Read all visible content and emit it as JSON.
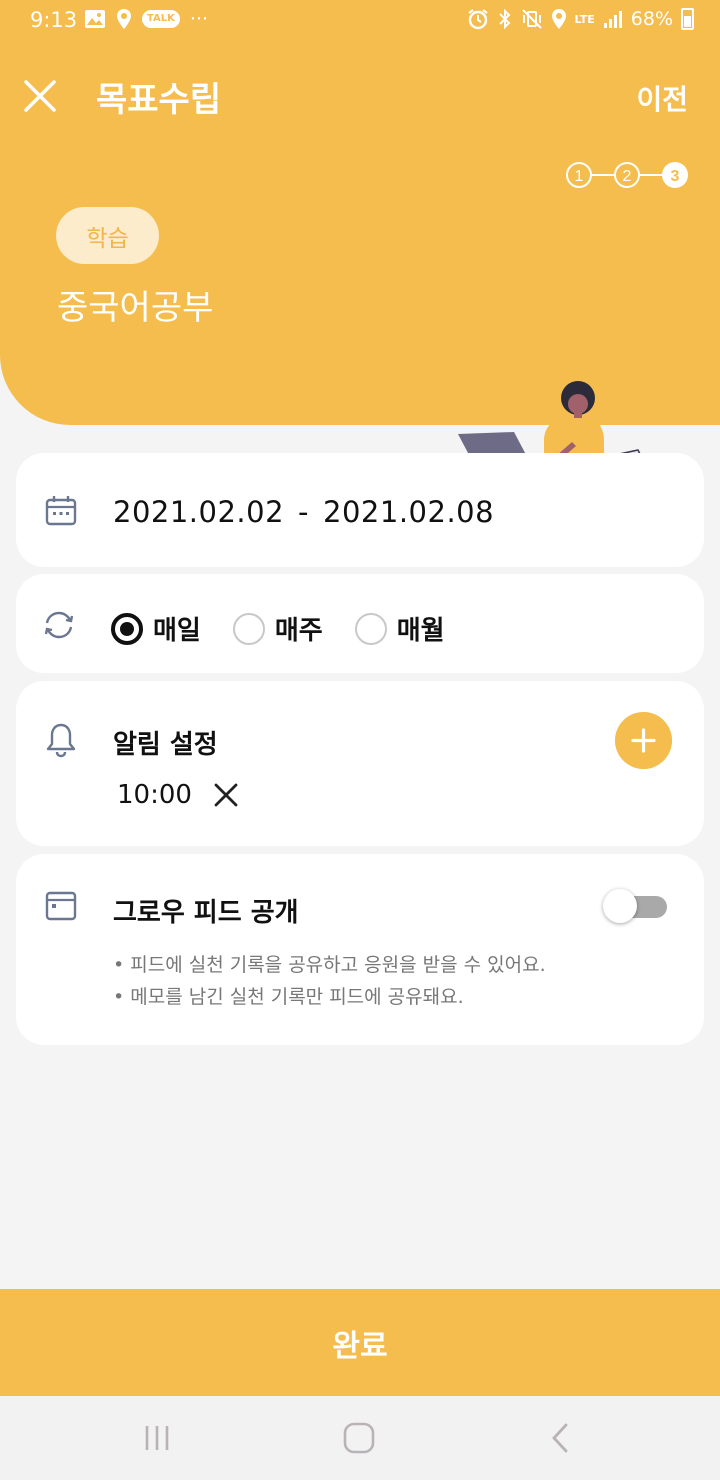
{
  "status_bar": {
    "time": "9:13",
    "talk_badge": "TALK",
    "more": "···",
    "network": "LTE",
    "battery": "68%"
  },
  "header": {
    "title": "목표수립",
    "prev_label": "이전",
    "steps": [
      "1",
      "2",
      "3"
    ],
    "current_step": 3
  },
  "goal": {
    "category": "학습",
    "name": "중국어공부"
  },
  "period": {
    "start": "2021.02.02",
    "separator": "-",
    "end": "2021.02.08"
  },
  "repeat": {
    "options": [
      {
        "label": "매일",
        "selected": true
      },
      {
        "label": "매주",
        "selected": false
      },
      {
        "label": "매월",
        "selected": false
      }
    ]
  },
  "alarm": {
    "title": "알림 설정",
    "time": "10:00"
  },
  "feed": {
    "title": "그로우 피드 공개",
    "enabled": false,
    "notes": [
      "• 피드에 실천 기록을 공유하고 응원을 받을 수 있어요.",
      "• 메모를 남긴 실천 기록만 피드에 공유돼요."
    ]
  },
  "footer": {
    "complete_label": "완료"
  },
  "colors": {
    "accent": "#f4bd4e",
    "background": "#f4f4f4",
    "badge_bg": "#fdeccb"
  }
}
